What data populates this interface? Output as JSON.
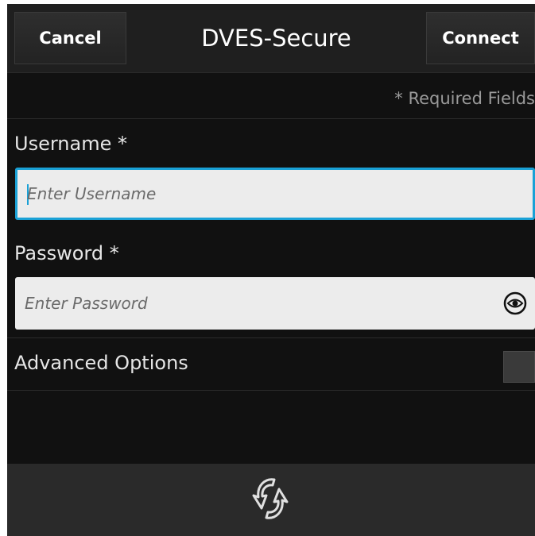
{
  "titlebar": {
    "cancel_label": "Cancel",
    "title": "DVES-Secure",
    "connect_label": "Connect"
  },
  "form": {
    "required_note": "* Required Fields",
    "username": {
      "label": "Username *",
      "placeholder": "Enter Username"
    },
    "password": {
      "label": "Password *",
      "placeholder": "Enter Password",
      "reveal_icon": "eye-icon"
    },
    "advanced": {
      "label": "Advanced Options",
      "checked": false
    }
  },
  "footer": {
    "logo_icon": "sync-logo-icon"
  },
  "colors": {
    "accent": "#1aa1d6",
    "background": "#111111",
    "titlebar": "#1f1f1f",
    "footer": "#2a2a2a"
  }
}
